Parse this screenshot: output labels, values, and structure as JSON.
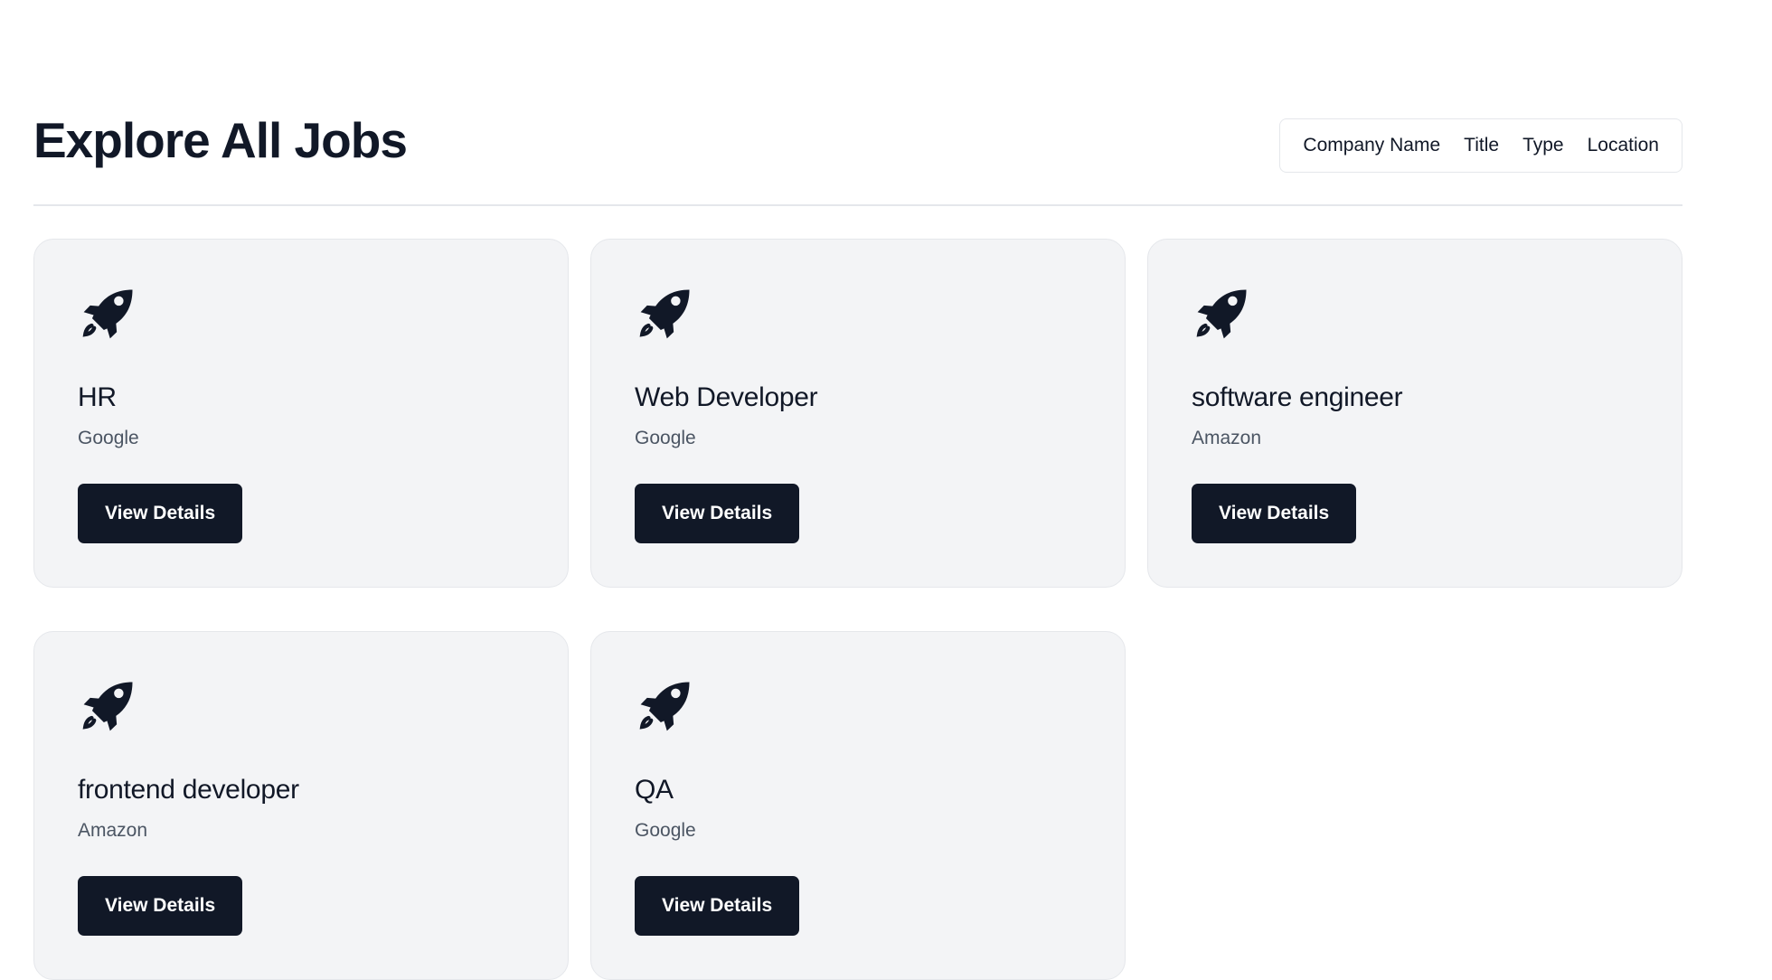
{
  "page": {
    "title": "Explore All Jobs"
  },
  "filters": [
    {
      "label": "Company Name"
    },
    {
      "label": "Title"
    },
    {
      "label": "Type"
    },
    {
      "label": "Location"
    }
  ],
  "jobs": [
    {
      "title": "HR",
      "company": "Google",
      "button_label": "View Details",
      "icon": "rocket-icon"
    },
    {
      "title": "Web Developer",
      "company": "Google",
      "button_label": "View Details",
      "icon": "rocket-icon"
    },
    {
      "title": "software engineer",
      "company": "Amazon",
      "button_label": "View Details",
      "icon": "rocket-icon"
    },
    {
      "title": "frontend developer",
      "company": "Amazon",
      "button_label": "View Details",
      "icon": "rocket-icon"
    },
    {
      "title": "QA",
      "company": "Google",
      "button_label": "View Details",
      "icon": "rocket-icon"
    }
  ],
  "colors": {
    "primary": "#111827",
    "card_bg": "#f3f4f6",
    "border": "#e5e7eb",
    "muted_text": "#4b5563"
  }
}
